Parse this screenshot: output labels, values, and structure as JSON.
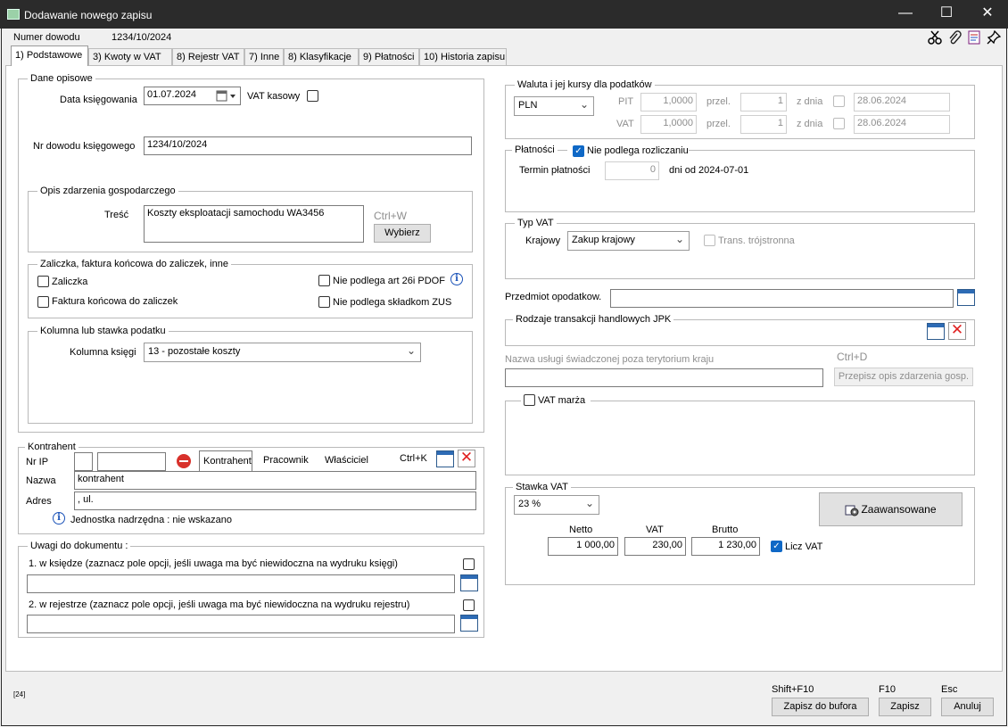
{
  "window": {
    "title": "Dodawanie nowego zapisu",
    "minimize": "—",
    "maximize": "☐",
    "close": "✕"
  },
  "header": {
    "doc_label": "Numer dowodu",
    "doc_value": "1234/10/2024",
    "tool_icons": [
      "scissors-icon",
      "paperclip-icon",
      "report-icon",
      "pin-icon"
    ]
  },
  "tabs": [
    "1) Podstawowe",
    "3) Kwoty w VAT",
    "8) Rejestr VAT",
    "7) Inne",
    "8) Klasyfikacje",
    "9) Płatności",
    "10) Historia zapisu"
  ],
  "dane": {
    "title": "Dane opisowe",
    "date_label": "Data księgowania",
    "date_value": "01.07.2024",
    "vat_kasowy_label": "VAT kasowy",
    "nr_label": "Nr dowodu księgowego",
    "nr_value": "1234/10/2024",
    "opis_title": "Opis zdarzenia gospodarczego",
    "tresc_label": "Treść",
    "tresc_value": "Koszty eksploatacji samochodu WA3456",
    "shortcut": "Ctrl+W",
    "wybierz": "Wybierz",
    "zal_title": "Zaliczka, faktura końcowa do zaliczek, inne",
    "zaliczka": "Zaliczka",
    "faktura_koncowa": "Faktura końcowa do zaliczek",
    "nie_pdof": "Nie podlega art 26i PDOF",
    "nie_zus": "Nie podlega składkom ZUS",
    "kol_title": "Kolumna lub stawka podatku",
    "kol_label": "Kolumna księgi",
    "kol_value": "13 - pozostałe koszty"
  },
  "kontrahent": {
    "title": "Kontrahent",
    "nrip_label": "Nr IP",
    "tabs": [
      "Kontrahent",
      "Pracownik",
      "Właściciel"
    ],
    "shortcut": "Ctrl+K",
    "nazwa_label": "Nazwa",
    "nazwa_value": "kontrahent",
    "adres_label": "Adres",
    "adres_value": ", ul.",
    "jednostka": "Jednostka nadrzędna : nie wskazano"
  },
  "uwagi": {
    "title": "Uwagi do dokumentu :",
    "ksiedze": "1. w księdze (zaznacz pole opcji, jeśli uwaga ma być niewidoczna na wydruku księgi)",
    "rejestrze": "2. w rejestrze (zaznacz pole opcji, jeśli uwaga ma być niewidoczna na wydruku rejestru)"
  },
  "waluta": {
    "title": "Waluta i jej kursy dla podatków",
    "currency": "PLN",
    "rows": [
      {
        "label": "PIT",
        "rate": "1,0000",
        "przel": "przel.",
        "count": "1",
        "zdnia": "z dnia",
        "date": "28.06.2024"
      },
      {
        "label": "VAT",
        "rate": "1,0000",
        "przel": "przel.",
        "count": "1",
        "zdnia": "z dnia",
        "date": "28.06.2024"
      }
    ]
  },
  "platnosci": {
    "title": "Płatności",
    "nie_podlega": "Nie podlega rozliczaniu",
    "termin_label": "Termin płatności",
    "termin_value": "0",
    "dni_od": "dni od 2024-07-01"
  },
  "typvat": {
    "title": "Typ VAT",
    "krajowy_label": "Krajowy",
    "krajowy_value": "Zakup krajowy",
    "trans": "Trans. trójstronna"
  },
  "przedmiot_label": "Przedmiot opodatkow.",
  "jpk_title": "Rodzaje transakcji handlowych JPK",
  "usluga": {
    "label": "Nazwa usługi świadczonej poza terytorium kraju",
    "shortcut": "Ctrl+D",
    "button": "Przepisz opis zdarzenia gosp."
  },
  "vat_marza": "VAT marża",
  "stawka": {
    "title": "Stawka VAT",
    "value": "23 %",
    "advanced": "Zaawansowane",
    "netto_label": "Netto",
    "vat_label": "VAT",
    "brutto_label": "Brutto",
    "netto": "1 000,00",
    "vat": "230,00",
    "brutto": "1 230,00",
    "licz_vat": "Licz VAT"
  },
  "footer": {
    "code": "[24]",
    "buf_shortcut": "Shift+F10",
    "buf_label": "Zapisz do bufora",
    "save_shortcut": "F10",
    "save_label": "Zapisz",
    "cancel_shortcut": "Esc",
    "cancel_label": "Anuluj"
  }
}
